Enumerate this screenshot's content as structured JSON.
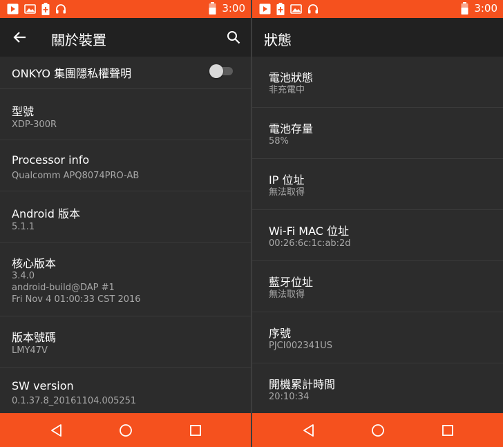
{
  "left": {
    "statusbar": {
      "time": "3:00",
      "icons": [
        "play-store-icon",
        "image-icon",
        "battery-plus-icon",
        "headphones-icon"
      ]
    },
    "appbar": {
      "title": "關於裝置"
    },
    "toggle_row": {
      "label": "ONKYO 集團隱私權聲明",
      "enabled": false
    },
    "items": [
      {
        "title": "型號",
        "lines": [
          "XDP-300R"
        ]
      },
      {
        "title": "Processor info",
        "lines": [
          "Qualcomm APQ8074PRO-AB"
        ]
      },
      {
        "title": "Android 版本",
        "lines": [
          "5.1.1"
        ]
      },
      {
        "title": "核心版本",
        "lines": [
          "3.4.0",
          "android-build@DAP #1",
          "Fri Nov 4 01:00:33 CST 2016"
        ]
      },
      {
        "title": "版本號碼",
        "lines": [
          "LMY47V"
        ]
      },
      {
        "title": "SW version",
        "lines": [
          "0.1.37.8_20161104.005251"
        ]
      }
    ]
  },
  "right": {
    "statusbar": {
      "time": "3:00",
      "icons": [
        "play-store-icon",
        "battery-plus-icon",
        "image-icon",
        "headphones-icon"
      ]
    },
    "appbar": {
      "title": "狀態"
    },
    "items": [
      {
        "title": "電池狀態",
        "value": "非充電中"
      },
      {
        "title": "電池存量",
        "value": "58%"
      },
      {
        "title": "IP 位址",
        "value": "無法取得"
      },
      {
        "title": "Wi-Fi MAC 位址",
        "value": "00:26:6c:1c:ab:2d"
      },
      {
        "title": "藍牙位址",
        "value": "無法取得"
      },
      {
        "title": "序號",
        "value": "PJCI002341US"
      },
      {
        "title": "開機累計時間",
        "value": "20:10:34"
      }
    ]
  },
  "colors": {
    "accent": "#f5511e",
    "appbar": "#212121",
    "background": "#2c2c2c",
    "subtext": "#a8a8a8"
  }
}
